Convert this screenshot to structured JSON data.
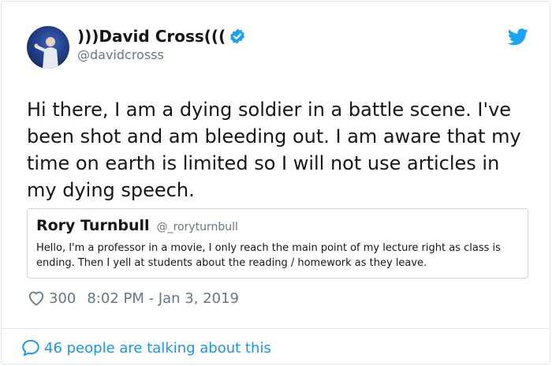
{
  "author": {
    "display_name": ")))David Cross(((",
    "handle": "@davidcrosss",
    "verified": true
  },
  "tweet": {
    "text": "Hi there, I am a dying soldier in a battle scene. I've been shot and am bleeding out. I am aware that my time on earth is limited so I will not use articles in my dying speech."
  },
  "quoted_tweet": {
    "display_name": "Rory Turnbull",
    "handle": "@_roryturnbull",
    "text": "Hello, I'm a professor in a movie, I only reach the main point of my lecture right as class is ending. Then I yell at students about the reading / homework as they leave."
  },
  "meta": {
    "like_count": "300",
    "timestamp": "8:02 PM - Jan 3, 2019"
  },
  "footer": {
    "talking_text": "46 people are talking about this"
  },
  "icons": {
    "verified": "verified-badge-icon",
    "brand": "twitter-bird-icon",
    "like": "heart-icon",
    "reply": "speech-bubble-icon"
  },
  "colors": {
    "brand_blue": "#1da1f2",
    "link_blue": "#1b95e0",
    "muted": "#657786",
    "text": "#14171a",
    "border": "#e1e8ed"
  }
}
